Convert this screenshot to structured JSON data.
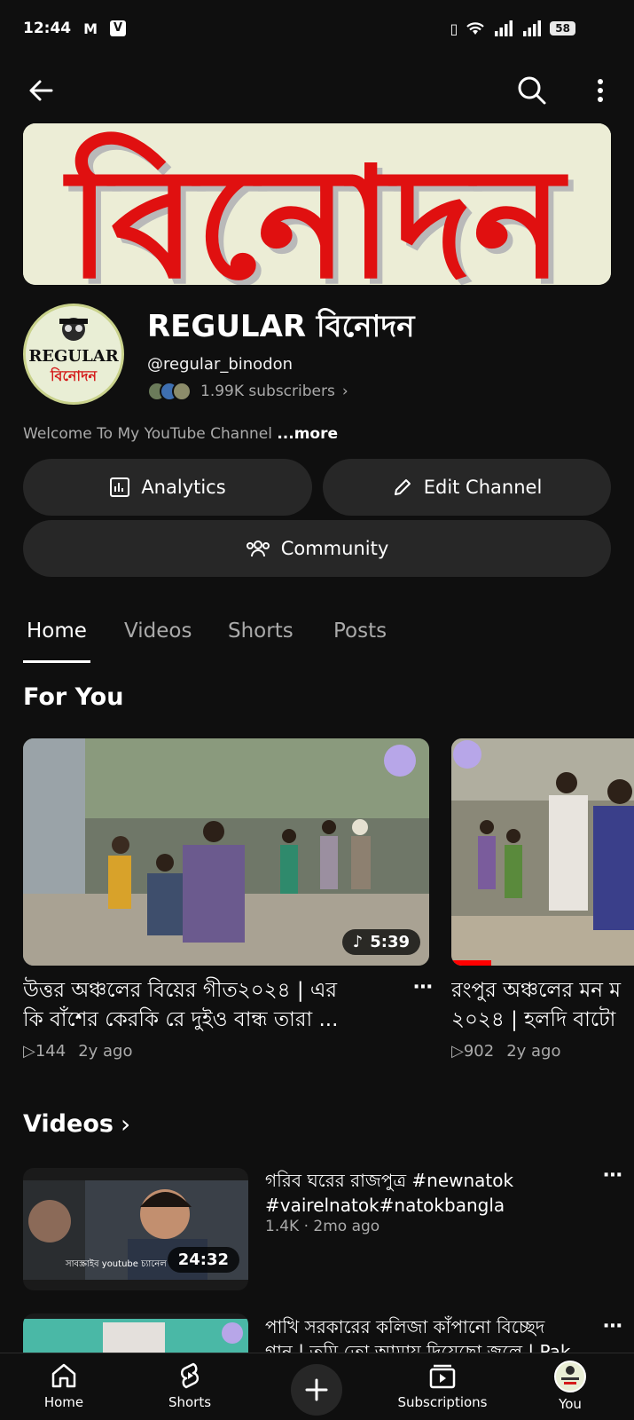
{
  "status": {
    "time": "12:44",
    "battery": "58"
  },
  "banner": {
    "text": "বিনোদন"
  },
  "avatar": {
    "line1": "REGULAR",
    "line2": "বিনোদন"
  },
  "channel": {
    "name": "REGULAR বিনোদন",
    "handle": "@regular_binodon",
    "subscribers": "1.99K subscribers",
    "description": "Welcome To My YouTube Channel",
    "more": "...more"
  },
  "actions": {
    "analytics": "Analytics",
    "edit": "Edit Channel",
    "community": "Community"
  },
  "tabs": [
    {
      "label": "Home"
    },
    {
      "label": "Videos"
    },
    {
      "label": "Shorts"
    },
    {
      "label": "Posts"
    }
  ],
  "for_you": {
    "title": "For You",
    "cards": [
      {
        "title_line1": "উত্তর অঞ্চলের বিয়ের গীত২০২৪ | এর",
        "title_line2": "কি বাঁশের কেরকি রে দুইও বান্ধ তারা ...",
        "views": "144",
        "age": "2y ago",
        "duration": "5:39"
      },
      {
        "title_line1": "রংপুর অঞ্চলের মন ম",
        "title_line2": "২০২৪ | হলদি বাটো",
        "views": "902",
        "age": "2y ago"
      }
    ]
  },
  "videos": {
    "title": "Videos",
    "items": [
      {
        "title_line1": "গরিব ঘরের রাজপুত্র #newnatok",
        "title_line2": "#vairelnatok#natokbangla",
        "meta": "1.4K · 2mo ago",
        "duration": "24:32",
        "overlay": "সাবস্ক্রাইব youtube চ্যানেল"
      },
      {
        "title_line1": "পাখি সরকারের কলিজা কাঁপানো বিচ্ছেদ",
        "title_line2": "গান | তুমি তো আমায় দিয়েছো জ্বলে | Pak"
      }
    ]
  },
  "nav": {
    "home": "Home",
    "shorts": "Shorts",
    "subscriptions": "Subscriptions",
    "you": "You"
  }
}
